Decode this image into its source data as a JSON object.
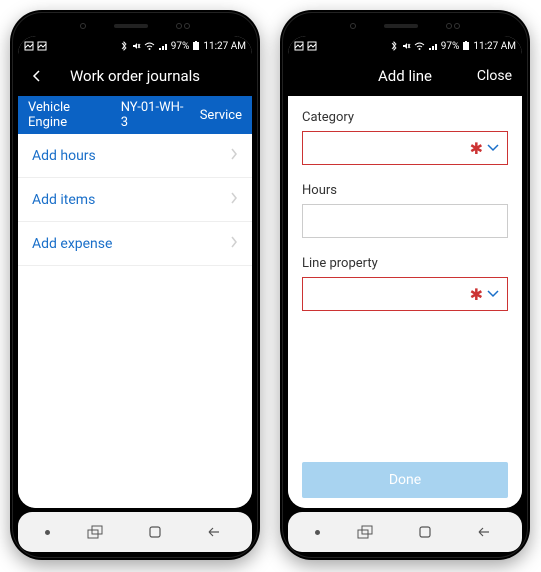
{
  "statusbar": {
    "battery": "97%",
    "time": "11:27 AM"
  },
  "left_phone": {
    "title": "Work order journals",
    "bluebar": {
      "col1": "Vehicle Engine",
      "col2": "NY-01-WH-3",
      "col3": "Service"
    },
    "items": [
      {
        "label": "Add hours"
      },
      {
        "label": "Add items"
      },
      {
        "label": "Add expense"
      }
    ]
  },
  "right_phone": {
    "title": "Add line",
    "close_label": "Close",
    "fields": {
      "category_label": "Category",
      "hours_label": "Hours",
      "line_property_label": "Line property"
    },
    "done_label": "Done"
  }
}
